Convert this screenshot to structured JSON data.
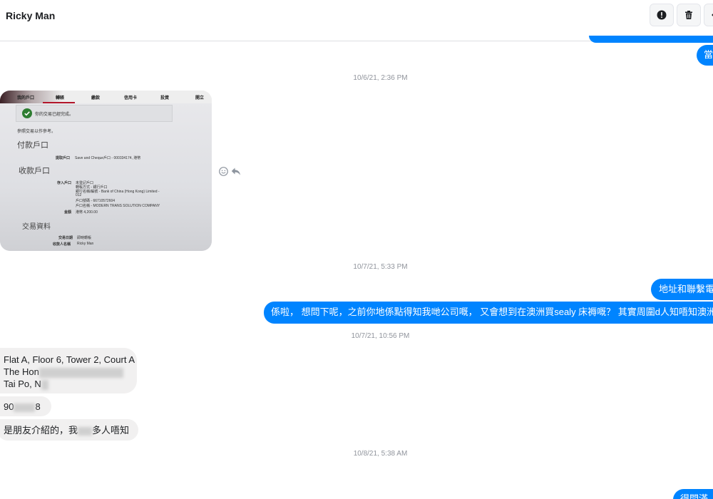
{
  "header": {
    "contact_name": "Ricky Man",
    "buttons": [
      "info-icon",
      "trash-icon",
      "more-icon"
    ]
  },
  "timestamps": {
    "t1": "10/6/21, 2:36 PM",
    "t2": "10/7/21, 5:33 PM",
    "t3": "10/7/21, 10:56 PM",
    "t4": "10/8/21, 5:38 AM"
  },
  "messages": {
    "top_out": "當",
    "out_addr": "地址和聯繫電",
    "out_long": "係啦， 想問下呢，之前你地係點得知我哋公司嘅， 又會想到在澳洲買sealy 床褥嘅？ 其實周圍d人知唔知澳洲的",
    "in_addr_line1": "Flat A, Floor 6, Tower 2, Court A",
    "in_addr_line2": "The Hon",
    "in_addr_line3": "Tai Po, N",
    "in_phone": "90",
    "in_phone_tail": "8",
    "in_friend_a": "是朋友介紹的，我",
    "in_friend_b": "多人唔知",
    "bottom_out": "得問滿"
  },
  "photo": {
    "tabs": [
      "我的戶口",
      "轉賬",
      "繳款",
      "信用卡",
      "投資",
      "開立"
    ],
    "success_msg": "你的交易已經完成。",
    "ref_line": "參照交易以作參考。",
    "section_pay": "付款戶口",
    "pay_label": "提取戶口",
    "pay_value": "Save and Cheque戶口 - 000334174, 港幣",
    "section_receive": "收款戶口",
    "recv_label": "存入戶口",
    "recv_lines": [
      "未登記戶口",
      "轉帳方式 - 銀行戶口",
      "銀行名稱/編號 - Bank of China (Hong Kong) Limited -",
      "012",
      "戶口號碼 - 66710572604",
      "戶口名稱 - MODERN TRANS SOLUTION COMPANY"
    ],
    "amount_label": "金額",
    "amount_value": "港幣 4,200.00",
    "section_txn": "交易資料",
    "txn_date_label": "交易日期",
    "txn_date_value": "即時轉帳",
    "txn_person_label": "收款人名稱",
    "txn_person_value": "Ricky Man"
  },
  "icons": {
    "react": "smile-icon",
    "reply": "reply-icon"
  },
  "colors": {
    "outgoing": "#0084ff",
    "incoming": "#f1f0f0",
    "timestamp": "#90949c"
  }
}
